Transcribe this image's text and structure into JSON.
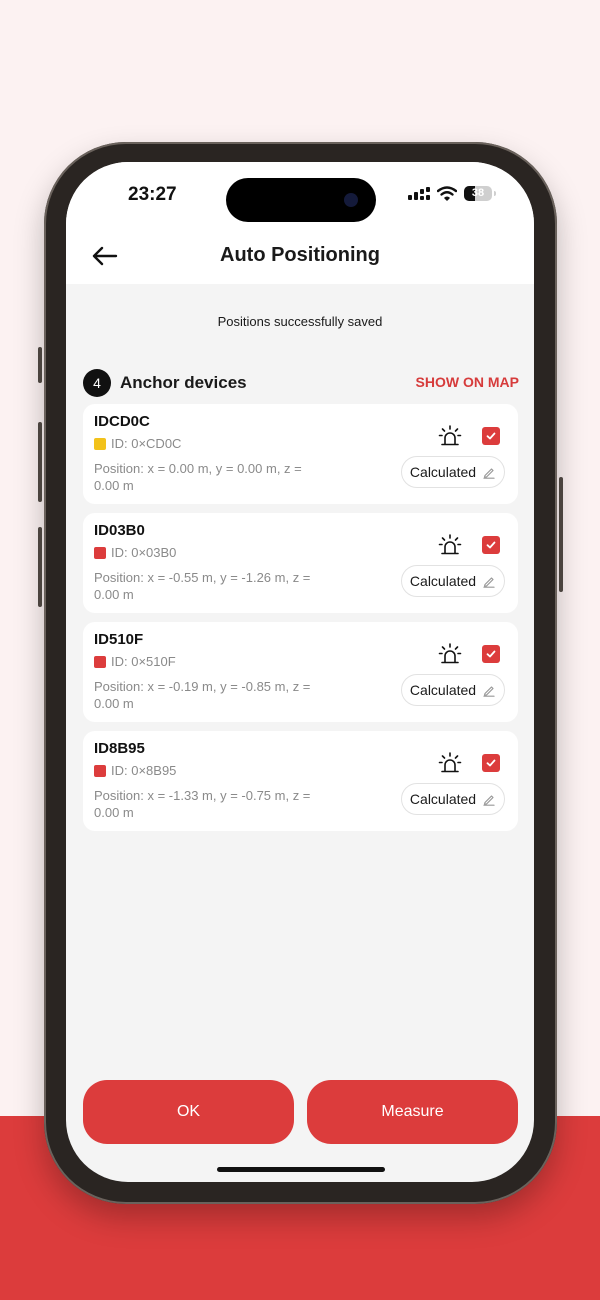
{
  "status_bar": {
    "time": "23:27",
    "battery": "38"
  },
  "header": {
    "title": "Auto Positioning"
  },
  "toast": "Positions successfully saved",
  "section": {
    "count": "4",
    "title": "Anchor devices",
    "show_on_map": "SHOW ON MAP"
  },
  "devices": [
    {
      "name": "IDCD0C",
      "id": "ID: 0×CD0C",
      "position": "Position: x = 0.00 m, y = 0.00 m, z = 0.00 m",
      "status": "Calculated",
      "color": "#f2c21b",
      "checked": true
    },
    {
      "name": "ID03B0",
      "id": "ID: 0×03B0",
      "position": "Position: x = -0.55 m, y = -1.26 m, z = 0.00 m",
      "status": "Calculated",
      "color": "#dc3c3c",
      "checked": true
    },
    {
      "name": "ID510F",
      "id": "ID: 0×510F",
      "position": "Position: x = -0.19 m, y = -0.85 m, z = 0.00 m",
      "status": "Calculated",
      "color": "#dc3c3c",
      "checked": true
    },
    {
      "name": "ID8B95",
      "id": "ID: 0×8B95",
      "position": "Position: x = -1.33 m, y = -0.75 m, z = 0.00 m",
      "status": "Calculated",
      "color": "#dc3c3c",
      "checked": true
    }
  ],
  "footer": {
    "ok": "OK",
    "measure": "Measure"
  },
  "colors": {
    "accent": "#dc3c3c",
    "background": "#fcf2f2",
    "screen": "#f4f4f4"
  }
}
